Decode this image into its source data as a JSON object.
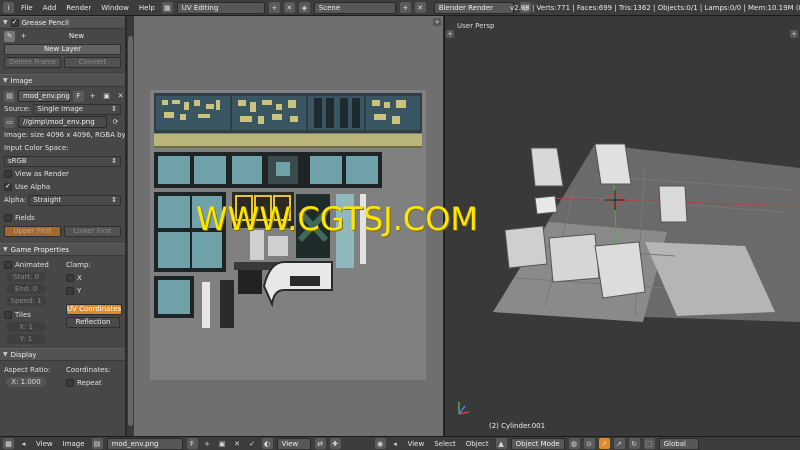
{
  "topbar": {
    "menus": [
      "File",
      "Add",
      "Render",
      "Window",
      "Help"
    ],
    "screen_layout": "UV Editing",
    "scene": "Scene",
    "render_engine": "Blender Render",
    "stats": "v2.68 | Verts:771 | Faces:699 | Tris:1362 | Objects:0/1 | Lamps:0/0 | Mem:10.19M (80.1"
  },
  "sidebar": {
    "grease_pencil": {
      "title": "Grease Pencil",
      "new": "New",
      "new_layer": "New Layer",
      "delete_frame": "Delete Frame",
      "convert": "Convert"
    },
    "image": {
      "title": "Image",
      "image_name": "mod_env.png",
      "fake_user": "F",
      "source_label": "Source:",
      "source_value": "Single Image",
      "filepath": "//gimp\\mod_env.png",
      "info": "Image: size 4096 x 4096, RGBA by",
      "color_space_label": "Input Color Space:",
      "color_space_value": "sRGB",
      "view_as_render": "View as Render",
      "use_alpha": "Use Alpha",
      "alpha_label": "Alpha:",
      "alpha_value": "Straight",
      "fields": "Fields",
      "upper_first": "Upper First",
      "lower_first": "Lower First"
    },
    "game_properties": {
      "title": "Game Properties",
      "animated": "Animated",
      "clamp": "Clamp:",
      "start": "Start: 0",
      "end": "End: 0",
      "speed": "Speed: 1",
      "x": "X",
      "y": "Y",
      "tiles": "Tiles",
      "uv_coordinates": "UV Coordinates",
      "reflection": "Reflection",
      "tx": "X: 1",
      "ty": "Y: 1"
    },
    "display": {
      "title": "Display",
      "aspect_ratio": "Aspect Ratio:",
      "coordinates": "Coordinates:",
      "aspect_x": "X: 1.000",
      "repeat": "Repeat"
    }
  },
  "viewport": {
    "label": "User Persp",
    "object_label": "(2) Cylinder.001"
  },
  "watermark": "WWW.CGTSJ.COM",
  "bottombar": {
    "uv_menus": [
      "View",
      "Image"
    ],
    "image_name": "mod_env.png",
    "fake_user": "F",
    "view_label": "View",
    "vp_menus": [
      "View",
      "Select",
      "Object"
    ],
    "mode": "Object Mode",
    "orientation": "Global"
  },
  "colors": {
    "accent": "#e0892a",
    "watermark": "#ffe600",
    "panel_bg": "#474747"
  }
}
